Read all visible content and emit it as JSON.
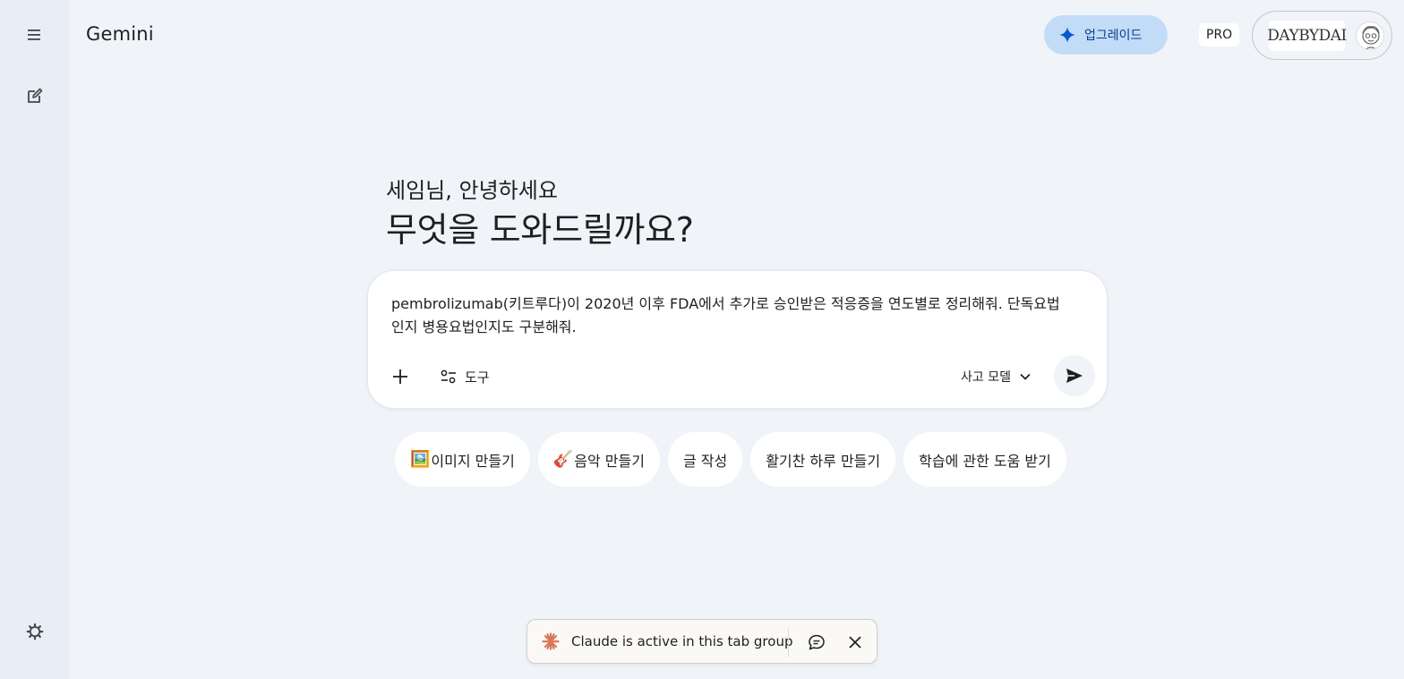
{
  "app": {
    "title": "Gemini"
  },
  "header": {
    "upgrade_label": "업그레이드",
    "plan_badge": "PRO",
    "account_logo_text": "DAYBYDAI"
  },
  "greeting": {
    "subtitle": "세임님, 안녕하세요",
    "title": "무엇을 도와드릴까요?"
  },
  "composer": {
    "prompt_value": "pembrolizumab(키트루다)이 2020년 이후 FDA에서 추가로 승인받은 적응증을 연도별로 정리해줘. 단독요법\n인지 병용요법인지도 구분해줘.",
    "tools_label": "도구",
    "model_label": "사고 모델"
  },
  "chips": [
    {
      "emoji": "🖼️",
      "label": "이미지 만들기"
    },
    {
      "emoji": "🎸",
      "label": "음악 만들기"
    },
    {
      "emoji": "",
      "label": "글 작성"
    },
    {
      "emoji": "",
      "label": "활기찬 하루 만들기"
    },
    {
      "emoji": "",
      "label": "학습에 관한 도움 받기"
    }
  ],
  "claude_bar": {
    "text": "Claude is active in this tab group"
  },
  "colors": {
    "background": "#f0f4f9",
    "rail": "#e9eef6",
    "upgrade_bg": "#c2dcf8",
    "claude_accent": "#d97757"
  }
}
